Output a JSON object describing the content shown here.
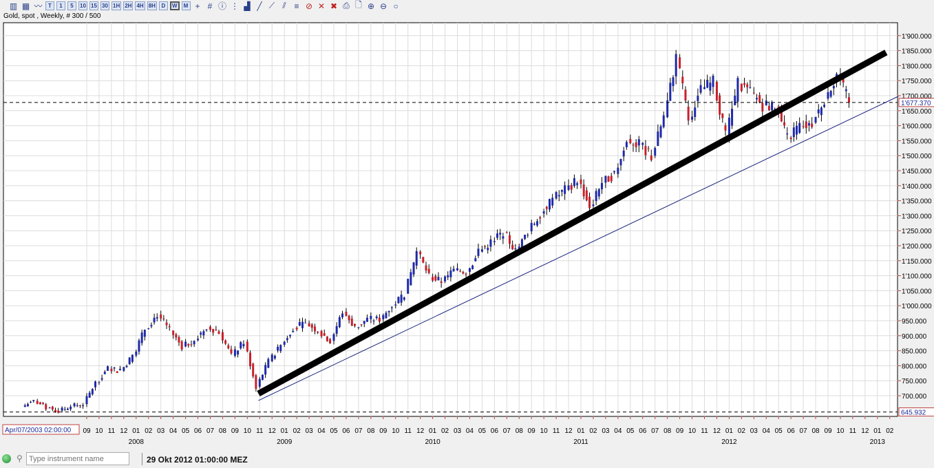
{
  "toolbar": {
    "timeframes": [
      "T",
      "1",
      "5",
      "10",
      "15",
      "30",
      "1H",
      "2H",
      "4H",
      "8H",
      "D",
      "W",
      "M"
    ],
    "selected": "W",
    "icons": [
      "candlestick-icon",
      "bar-chart-icon",
      "line-chart-icon",
      "crosshair-icon",
      "grid-icon",
      "info-icon",
      "indicator-icon",
      "volume-icon",
      "draw-line-icon",
      "trendline-icon",
      "channel-icon",
      "fib-icon",
      "delete-drawing-icon",
      "delete-icon",
      "delete-all-icon",
      "print-icon",
      "print-preview-icon",
      "zoom-in-icon",
      "zoom-out-icon",
      "zoom-reset-icon"
    ]
  },
  "chart_title": "Gold, spot , Weekly, # 300 / 500",
  "chart_data": {
    "type": "candlestick",
    "instrument": "Gold, spot",
    "y_ticks": [
      "1'900.000",
      "1'850.000",
      "1'800.000",
      "1'750.000",
      "1'700.000",
      "1'650.000",
      "1'600.000",
      "1'550.000",
      "1'500.000",
      "1'450.000",
      "1'400.000",
      "1'350.000",
      "1'300.000",
      "1'250.000",
      "1'200.000",
      "1'150.000",
      "1'100.000",
      "1'050.000",
      "1'000.000",
      "950.000",
      "900.000",
      "850.000",
      "800.000",
      "750.000",
      "700.000"
    ],
    "ylim": [
      645,
      1930
    ],
    "x_month_labels": [
      "09",
      "10",
      "11",
      "12",
      "01",
      "02",
      "03",
      "04",
      "05",
      "06",
      "07",
      "08",
      "09",
      "10",
      "11",
      "12",
      "01",
      "02",
      "03",
      "04",
      "05",
      "06",
      "07",
      "08",
      "09",
      "10",
      "11",
      "12",
      "01",
      "02",
      "03",
      "04",
      "05",
      "06",
      "07",
      "08",
      "09",
      "10",
      "11",
      "12",
      "01",
      "02",
      "03",
      "04",
      "05",
      "06",
      "07",
      "08",
      "09",
      "10",
      "11",
      "12",
      "01",
      "02",
      "03",
      "04",
      "05",
      "06",
      "07",
      "08",
      "09",
      "10",
      "11",
      "12",
      "01",
      "02"
    ],
    "x_start_month": "2007-09",
    "x_year_labels": [
      {
        "label": "2008",
        "month": "2008-01"
      },
      {
        "label": "2009",
        "month": "2009-01"
      },
      {
        "label": "2010",
        "month": "2010-01"
      },
      {
        "label": "2011",
        "month": "2011-01"
      },
      {
        "label": "2012",
        "month": "2012-01"
      },
      {
        "label": "2013",
        "month": "2013-01"
      }
    ],
    "monthly_closes": {
      "start": "2007-03",
      "values": [
        663,
        683,
        660,
        650,
        665,
        672,
        743,
        790,
        783,
        834,
        923,
        971,
        917,
        864,
        885,
        930,
        912,
        833,
        880,
        730,
        815,
        870,
        927,
        942,
        916,
        883,
        980,
        927,
        955,
        955,
        1001,
        1040,
        1180,
        1096,
        1081,
        1118,
        1113,
        1180,
        1212,
        1244,
        1181,
        1248,
        1307,
        1357,
        1386,
        1421,
        1332,
        1410,
        1439,
        1556,
        1536,
        1500,
        1628,
        1828,
        1620,
        1722,
        1746,
        1565,
        1740,
        1710,
        1668,
        1664,
        1560,
        1598,
        1610,
        1690,
        1772,
        1677
      ]
    },
    "up_color": "#1e2aa8",
    "down_color": "#c8202a",
    "horizontal_lines": [
      {
        "price": 1677.37,
        "label": "1'677.370"
      },
      {
        "price": 645.932,
        "label": "645.932"
      }
    ],
    "trendlines": [
      {
        "style": "thick",
        "color": "#000000",
        "from": {
          "month": 13.9,
          "price": 707
        },
        "to": {
          "month": 64.7,
          "price": 1844
        }
      },
      {
        "style": "thin",
        "color": "#1a237e",
        "from": {
          "month": 13.9,
          "price": 684
        },
        "to": {
          "month": 65.7,
          "price": 1698
        }
      }
    ],
    "cursor_date": "Apr/07/2003 02:00:00"
  },
  "status": {
    "search_placeholder": "Type instrument name",
    "datetime": "29 Okt 2012 01:00:00 MEZ"
  }
}
